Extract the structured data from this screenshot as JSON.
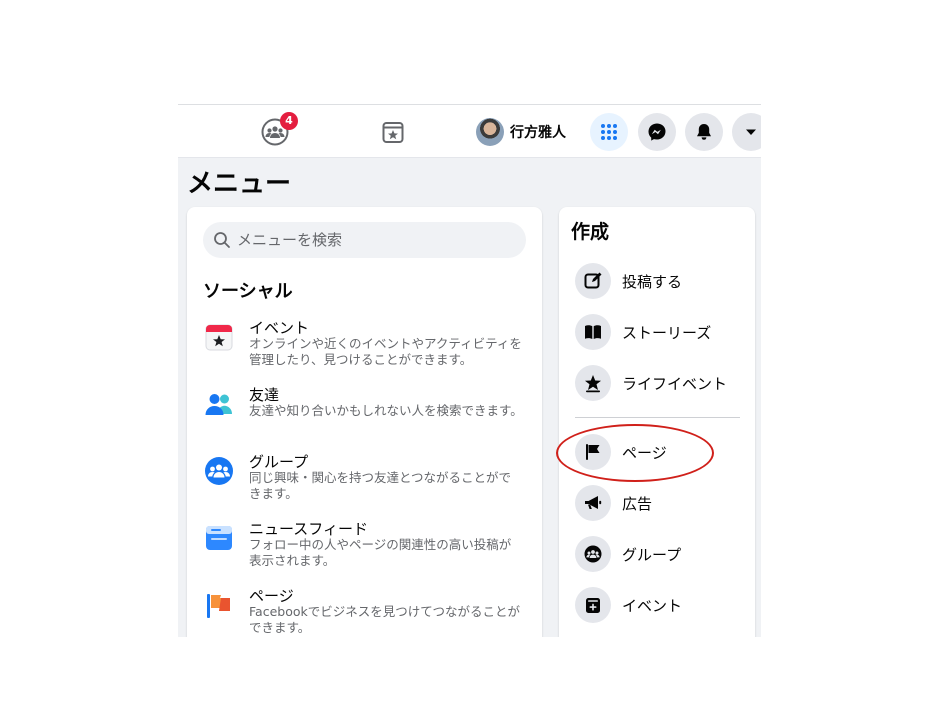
{
  "topbar": {
    "groups_badge": "4",
    "user_name": "行方雅人"
  },
  "menu": {
    "title": "メニュー"
  },
  "search": {
    "placeholder": "メニューを検索"
  },
  "social": {
    "title": "ソーシャル",
    "items": [
      {
        "title": "イベント",
        "desc": "オンラインや近くのイベントやアクティビティを管理したり、見つけることができます。",
        "icon": "calendar-icon"
      },
      {
        "title": "友達",
        "desc": "友達や知り合いかもしれない人を検索できます。",
        "icon": "friends-icon"
      },
      {
        "title": "グループ",
        "desc": "同じ興味・関心を持つ友達とつながることができます。",
        "icon": "groups-icon"
      },
      {
        "title": "ニュースフィード",
        "desc": "フォロー中の人やページの関連性の高い投稿が表示されます。",
        "icon": "news-feed-icon"
      },
      {
        "title": "ページ",
        "desc": "Facebookでビジネスを見つけてつながることができます。",
        "icon": "pages-flag-icon"
      }
    ]
  },
  "create": {
    "title": "作成",
    "items": [
      {
        "label": "投稿する",
        "icon": "compose-icon"
      },
      {
        "label": "ストーリーズ",
        "icon": "book-icon"
      },
      {
        "label": "ライフイベント",
        "icon": "star-icon"
      },
      {
        "label": "ページ",
        "icon": "flag-icon"
      },
      {
        "label": "広告",
        "icon": "megaphone-icon"
      },
      {
        "label": "グループ",
        "icon": "groups-icon"
      },
      {
        "label": "イベント",
        "icon": "event-icon"
      }
    ]
  },
  "colors": {
    "brand": "#1877f2",
    "badge": "#e41e3f",
    "annotation": "#d0201a"
  }
}
